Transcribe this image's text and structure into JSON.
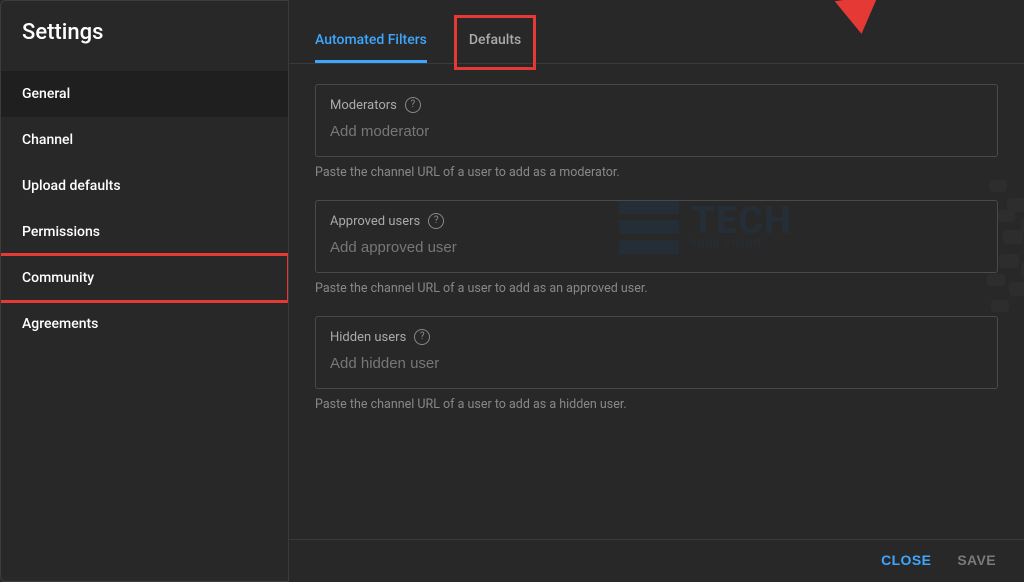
{
  "sidebar": {
    "title": "Settings",
    "items": [
      {
        "label": "General"
      },
      {
        "label": "Channel"
      },
      {
        "label": "Upload defaults"
      },
      {
        "label": "Permissions"
      },
      {
        "label": "Community"
      },
      {
        "label": "Agreements"
      }
    ],
    "activeIndex": 4
  },
  "tabs": {
    "items": [
      {
        "label": "Automated Filters"
      },
      {
        "label": "Defaults"
      }
    ],
    "activeIndex": 0
  },
  "sections": {
    "moderators": {
      "label": "Moderators",
      "placeholder": "Add moderator",
      "hint": "Paste the channel URL of a user to add as a moderator."
    },
    "approved": {
      "label": "Approved users",
      "placeholder": "Add approved user",
      "hint": "Paste the channel URL of a user to add as an approved user."
    },
    "hidden": {
      "label": "Hidden users",
      "placeholder": "Add hidden user",
      "hint": "Paste the channel URL of a user to add as a hidden user."
    }
  },
  "footer": {
    "close": "CLOSE",
    "save": "SAVE"
  }
}
